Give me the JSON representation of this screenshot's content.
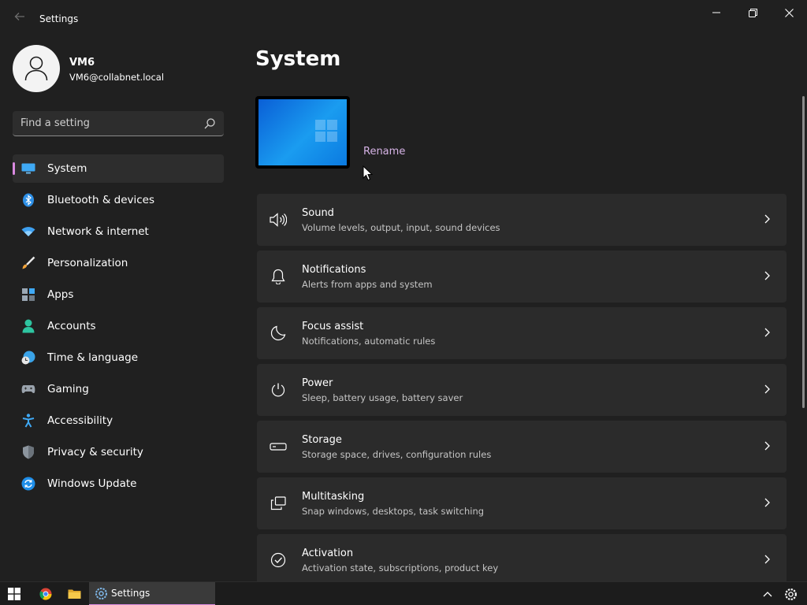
{
  "window": {
    "title": "Settings",
    "back_icon": "back-arrow-icon"
  },
  "profile": {
    "name": "VM6",
    "email": "VM6@collabnet.local"
  },
  "search": {
    "placeholder": "Find a setting"
  },
  "nav": {
    "items": [
      {
        "label": "System",
        "icon": "system-icon",
        "selected": true
      },
      {
        "label": "Bluetooth & devices",
        "icon": "bluetooth-icon"
      },
      {
        "label": "Network & internet",
        "icon": "wifi-icon"
      },
      {
        "label": "Personalization",
        "icon": "brush-icon"
      },
      {
        "label": "Apps",
        "icon": "apps-icon"
      },
      {
        "label": "Accounts",
        "icon": "person-icon"
      },
      {
        "label": "Time & language",
        "icon": "clock-globe-icon"
      },
      {
        "label": "Gaming",
        "icon": "gamepad-icon"
      },
      {
        "label": "Accessibility",
        "icon": "accessibility-icon"
      },
      {
        "label": "Privacy & security",
        "icon": "shield-icon"
      },
      {
        "label": "Windows Update",
        "icon": "update-icon"
      }
    ]
  },
  "main": {
    "title": "System",
    "rename": "Rename",
    "cards": [
      {
        "title": "Sound",
        "subtitle": "Volume levels, output, input, sound devices",
        "icon": "speaker-icon"
      },
      {
        "title": "Notifications",
        "subtitle": "Alerts from apps and system",
        "icon": "bell-icon"
      },
      {
        "title": "Focus assist",
        "subtitle": "Notifications, automatic rules",
        "icon": "moon-icon"
      },
      {
        "title": "Power",
        "subtitle": "Sleep, battery usage, battery saver",
        "icon": "power-icon"
      },
      {
        "title": "Storage",
        "subtitle": "Storage space, drives, configuration rules",
        "icon": "drive-icon"
      },
      {
        "title": "Multitasking",
        "subtitle": "Snap windows, desktops, task switching",
        "icon": "multitask-icon"
      },
      {
        "title": "Activation",
        "subtitle": "Activation state, subscriptions, product key",
        "icon": "check-circle-icon"
      }
    ]
  },
  "taskbar": {
    "settings_label": "Settings"
  },
  "colors": {
    "background": "#202020",
    "card": "#2b2b2b",
    "accent": "#d989e0",
    "link": "#d6b3e6"
  }
}
